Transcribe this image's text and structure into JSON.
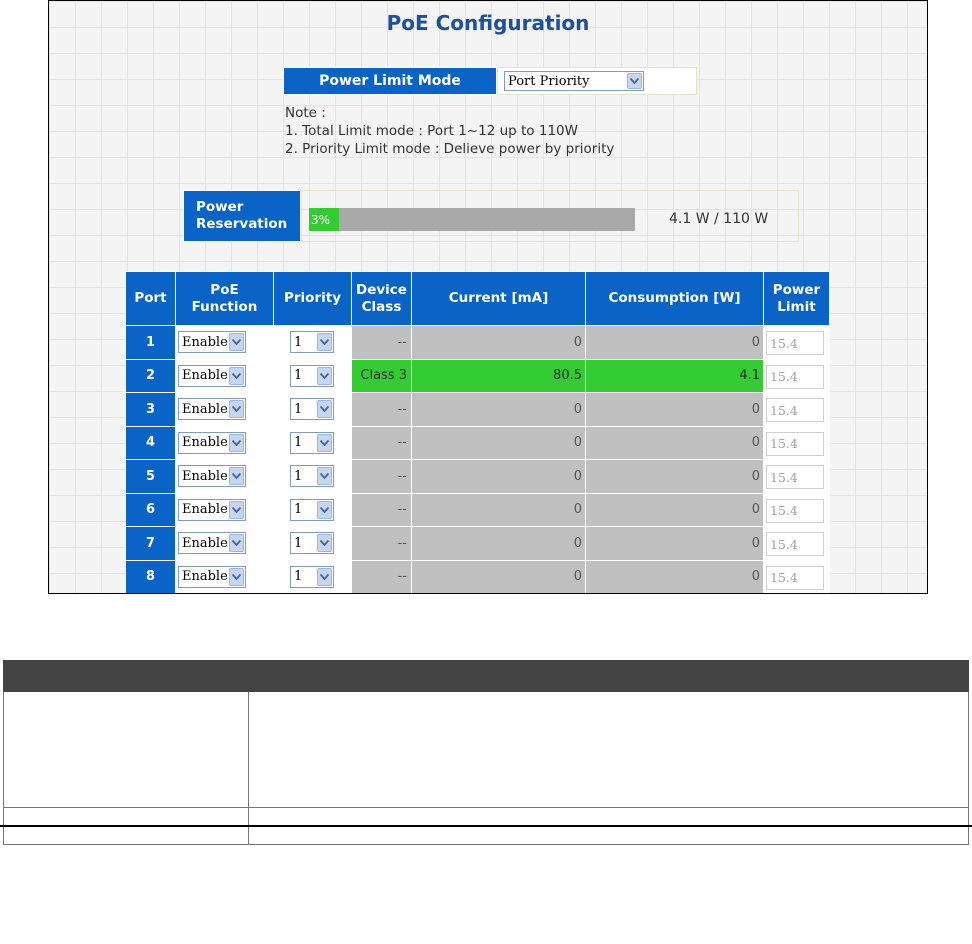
{
  "page": {
    "title": "PoE Configuration"
  },
  "power_limit_mode": {
    "label": "Power Limit Mode",
    "selected": "Port Priority"
  },
  "note": {
    "heading": "Note :",
    "lines": [
      "1. Total Limit mode : Port 1~12 up to 110W",
      "2. Priority Limit mode : Delieve power by priority"
    ]
  },
  "power_reservation": {
    "label_line1": "Power",
    "label_line2": "Reservation",
    "percent_text": "3%",
    "fraction": 0.03,
    "summary": "4.1 W / 110 W",
    "bar_color": "#33cc33"
  },
  "table": {
    "headers": {
      "port": "Port",
      "poe_function_1": "PoE",
      "poe_function_2": "Function",
      "priority": "Priority",
      "device_class_1": "Device",
      "device_class_2": "Class",
      "current": "Current [mA]",
      "consumption": "Consumption [W]",
      "power_limit_1": "Power",
      "power_limit_2": "Limit"
    },
    "rows": [
      {
        "port": "1",
        "function": "Enable",
        "priority": "1",
        "device_class": "--",
        "current": "0",
        "consumption": "0",
        "limit": "15.4",
        "active": false
      },
      {
        "port": "2",
        "function": "Enable",
        "priority": "1",
        "device_class": "Class 3",
        "current": "80.5",
        "consumption": "4.1",
        "limit": "15.4",
        "active": true
      },
      {
        "port": "3",
        "function": "Enable",
        "priority": "1",
        "device_class": "--",
        "current": "0",
        "consumption": "0",
        "limit": "15.4",
        "active": false
      },
      {
        "port": "4",
        "function": "Enable",
        "priority": "1",
        "device_class": "--",
        "current": "0",
        "consumption": "0",
        "limit": "15.4",
        "active": false
      },
      {
        "port": "5",
        "function": "Enable",
        "priority": "1",
        "device_class": "--",
        "current": "0",
        "consumption": "0",
        "limit": "15.4",
        "active": false
      },
      {
        "port": "6",
        "function": "Enable",
        "priority": "1",
        "device_class": "--",
        "current": "0",
        "consumption": "0",
        "limit": "15.4",
        "active": false
      },
      {
        "port": "7",
        "function": "Enable",
        "priority": "1",
        "device_class": "--",
        "current": "0",
        "consumption": "0",
        "limit": "15.4",
        "active": false
      },
      {
        "port": "8",
        "function": "Enable",
        "priority": "1",
        "device_class": "--",
        "current": "0",
        "consumption": "0",
        "limit": "15.4",
        "active": false
      }
    ]
  },
  "colors": {
    "header_blue": "#0a64c8",
    "title_blue": "#1d4fa0",
    "active_green": "#33cc33",
    "inactive_gray": "#c0c0c0"
  }
}
